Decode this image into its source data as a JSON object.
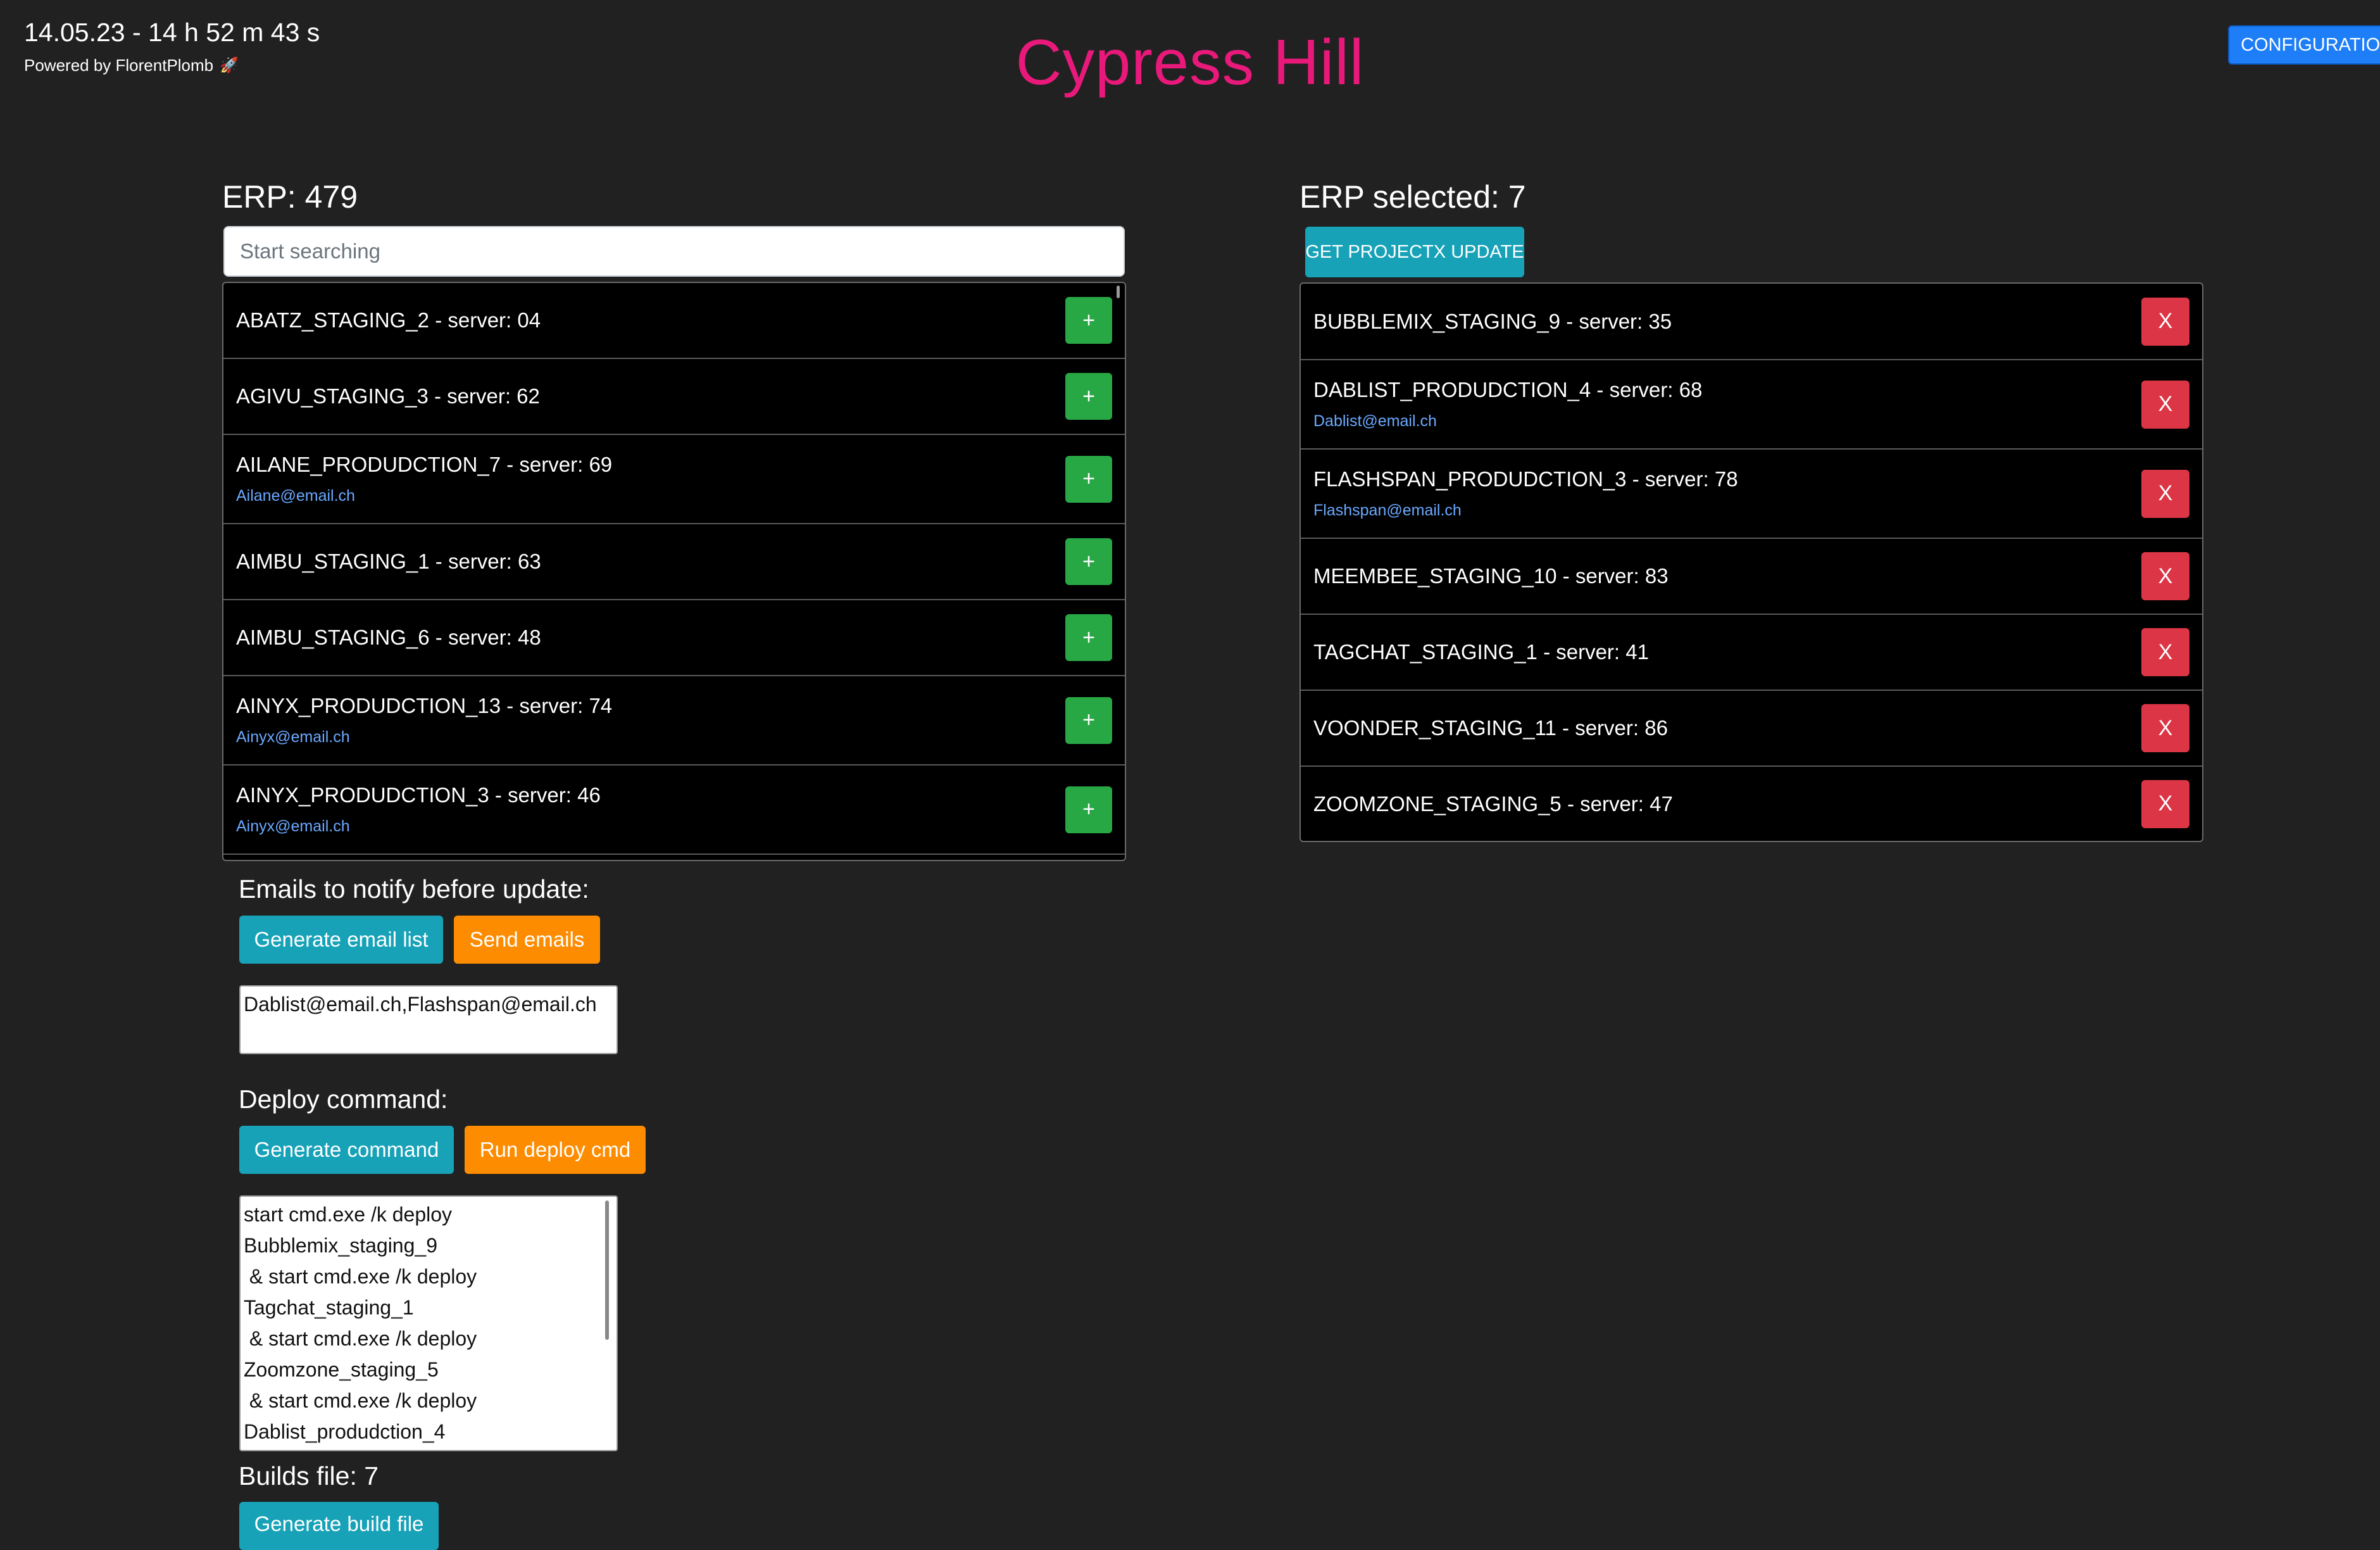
{
  "header": {
    "datetime": "14.05.23 - 14 h 52 m 43 s",
    "powered_by": "Powered by FlorentPlomb",
    "rocket_icon": "🚀",
    "title": "Cypress Hill",
    "config_label": "CONFIGURATION"
  },
  "erp_list": {
    "heading": "ERP: 479",
    "search_placeholder": "Start searching",
    "add_label": "+",
    "items": [
      {
        "name": "ABATZ_STAGING_2 - server: 04",
        "email": ""
      },
      {
        "name": "AGIVU_STAGING_3 - server: 62",
        "email": ""
      },
      {
        "name": "AILANE_PRODUDCTION_7 - server: 69",
        "email": "Ailane@email.ch"
      },
      {
        "name": "AIMBU_STAGING_1 - server: 63",
        "email": ""
      },
      {
        "name": "AIMBU_STAGING_6 - server: 48",
        "email": ""
      },
      {
        "name": "AINYX_PRODUDCTION_13 - server: 74",
        "email": "Ainyx@email.ch"
      },
      {
        "name": "AINYX_PRODUDCTION_3 - server: 46",
        "email": "Ainyx@email.ch"
      }
    ]
  },
  "selected": {
    "heading": "ERP selected: 7",
    "update_label": "GET PROJECTX UPDATE",
    "remove_label": "X",
    "items": [
      {
        "name": "BUBBLEMIX_STAGING_9 - server: 35",
        "email": ""
      },
      {
        "name": "DABLIST_PRODUDCTION_4 - server: 68",
        "email": "Dablist@email.ch"
      },
      {
        "name": "FLASHSPAN_PRODUDCTION_3 - server: 78",
        "email": "Flashspan@email.ch"
      },
      {
        "name": "MEEMBEE_STAGING_10 - server: 83",
        "email": ""
      },
      {
        "name": "TAGCHAT_STAGING_1 - server: 41",
        "email": ""
      },
      {
        "name": "VOONDER_STAGING_11 - server: 86",
        "email": ""
      },
      {
        "name": "ZOOMZONE_STAGING_5 - server: 47",
        "email": ""
      }
    ]
  },
  "emails": {
    "heading": "Emails to notify before update:",
    "generate_label": "Generate email list",
    "send_label": "Send emails",
    "value": "Dablist@email.ch,Flashspan@email.ch"
  },
  "deploy": {
    "heading": "Deploy command:",
    "generate_label": "Generate command",
    "run_label": "Run deploy cmd",
    "value": "start cmd.exe /k deploy\nBubblemix_staging_9\n & start cmd.exe /k deploy\nTagchat_staging_1\n & start cmd.exe /k deploy\nZoomzone_staging_5\n & start cmd.exe /k deploy\nDablist_produdction_4"
  },
  "builds": {
    "heading": "Builds file: 7",
    "generate_label": "Generate build file"
  },
  "colors": {
    "background": "#212121",
    "title": "#e8197a",
    "success": "#28a745",
    "danger": "#dc3545",
    "info": "#17a2b8",
    "warning": "#fd8c00",
    "primary": "#1e7ef7",
    "email_link": "#6aa9ff"
  }
}
